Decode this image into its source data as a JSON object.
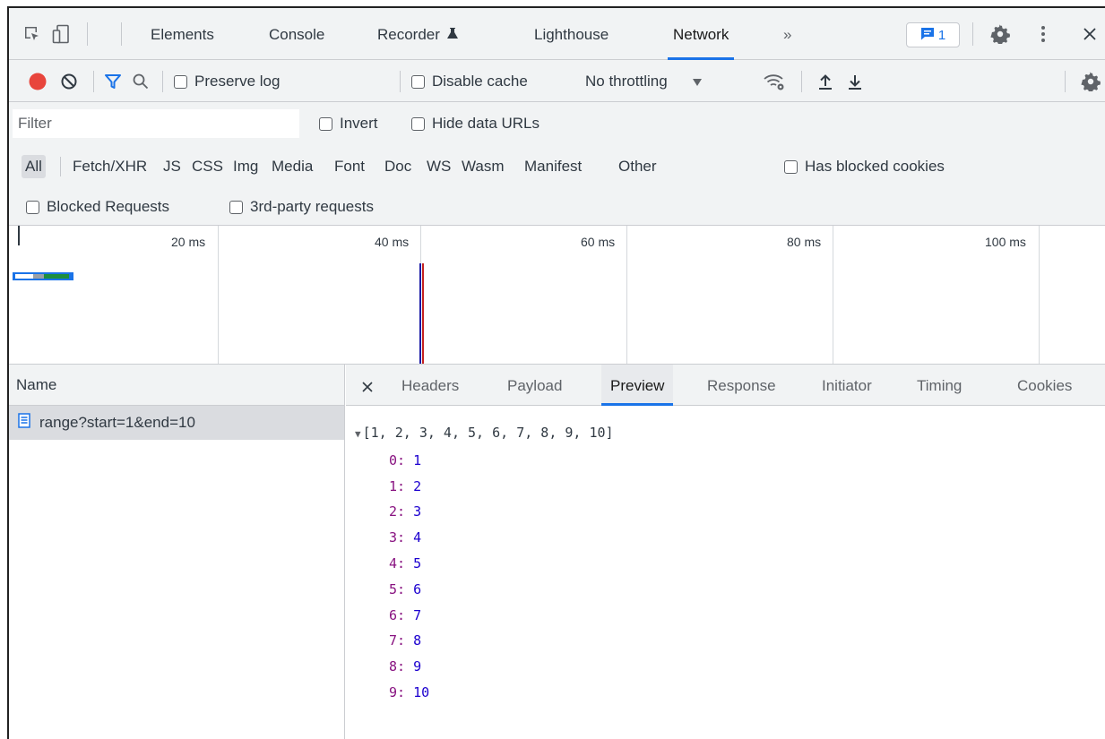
{
  "tabs": [
    {
      "label": "Elements"
    },
    {
      "label": "Console"
    },
    {
      "label": "Recorder"
    },
    {
      "label": "Lighthouse"
    },
    {
      "label": "Network"
    }
  ],
  "tabs_more": "»",
  "active_tab": "Network",
  "issues_count": "1",
  "toolbar": {
    "preserve_log": "Preserve log",
    "disable_cache": "Disable cache",
    "throttling": "No throttling"
  },
  "filter": {
    "placeholder": "Filter",
    "invert": "Invert",
    "hide_data_urls": "Hide data URLs"
  },
  "types": [
    "All",
    "Fetch/XHR",
    "JS",
    "CSS",
    "Img",
    "Media",
    "Font",
    "Doc",
    "WS",
    "Wasm",
    "Manifest",
    "Other"
  ],
  "has_blocked_cookies": "Has blocked cookies",
  "blocked_requests": "Blocked Requests",
  "third_party": "3rd-party requests",
  "timeline": {
    "ticks": [
      "20 ms",
      "40 ms",
      "60 ms",
      "80 ms",
      "100 ms"
    ]
  },
  "requests": {
    "header": "Name",
    "items": [
      {
        "name": "range?start=1&end=10"
      }
    ]
  },
  "detail_tabs": [
    "Headers",
    "Payload",
    "Preview",
    "Response",
    "Initiator",
    "Timing",
    "Cookies"
  ],
  "active_detail_tab": "Preview",
  "preview": {
    "summary": "[1, 2, 3, 4, 5, 6, 7, 8, 9, 10]",
    "entries": [
      {
        "key": "0",
        "value": "1"
      },
      {
        "key": "1",
        "value": "2"
      },
      {
        "key": "2",
        "value": "3"
      },
      {
        "key": "3",
        "value": "4"
      },
      {
        "key": "4",
        "value": "5"
      },
      {
        "key": "5",
        "value": "6"
      },
      {
        "key": "6",
        "value": "7"
      },
      {
        "key": "7",
        "value": "8"
      },
      {
        "key": "8",
        "value": "9"
      },
      {
        "key": "9",
        "value": "10"
      }
    ]
  },
  "colors": {
    "accent": "#1a73e8",
    "record": "#e8453c",
    "dom_content_loaded": "#1a1aa6",
    "load": "#c5221f"
  }
}
